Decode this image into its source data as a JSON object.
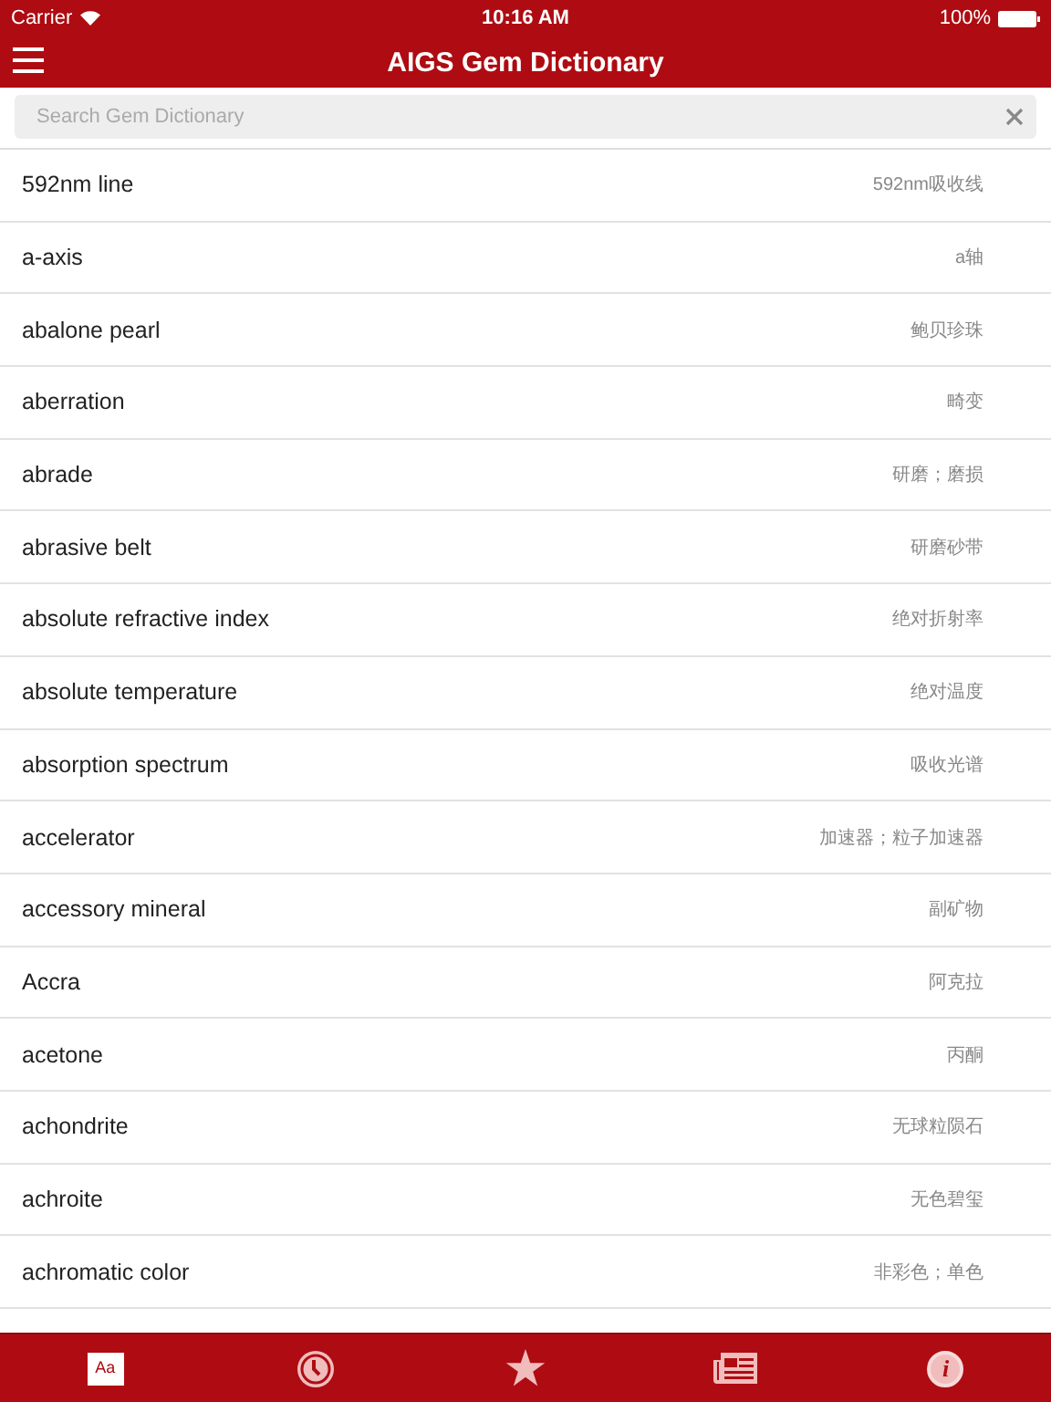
{
  "status_bar": {
    "carrier": "Carrier",
    "time": "10:16 AM",
    "battery": "100%"
  },
  "nav_bar": {
    "title": "AIGS Gem Dictionary"
  },
  "search": {
    "placeholder": "Search Gem Dictionary"
  },
  "entries": [
    {
      "term": "592nm line",
      "translation": "592nm吸收线"
    },
    {
      "term": "a-axis",
      "translation": "a轴"
    },
    {
      "term": "abalone pearl",
      "translation": "鲍贝珍珠"
    },
    {
      "term": "aberration",
      "translation": "畸变"
    },
    {
      "term": "abrade",
      "translation": "研磨；磨损"
    },
    {
      "term": "abrasive belt",
      "translation": "研磨砂带"
    },
    {
      "term": "absolute refractive index",
      "translation": "绝对折射率"
    },
    {
      "term": "absolute temperature",
      "translation": "绝对温度"
    },
    {
      "term": "absorption spectrum",
      "translation": "吸收光谱"
    },
    {
      "term": "accelerator",
      "translation": "加速器；粒子加速器"
    },
    {
      "term": "accessory mineral",
      "translation": "副矿物"
    },
    {
      "term": "Accra",
      "translation": "阿克拉"
    },
    {
      "term": "acetone",
      "translation": "丙酮"
    },
    {
      "term": "achondrite",
      "translation": "无球粒陨石"
    },
    {
      "term": "achroite",
      "translation": "无色碧玺"
    },
    {
      "term": "achromatic color",
      "translation": "非彩色；单色"
    }
  ],
  "tab_bar": [
    {
      "kind": "dictionary",
      "glyph": "Aa",
      "selected": true
    },
    {
      "kind": "history",
      "selected": false
    },
    {
      "kind": "favorites",
      "selected": false
    },
    {
      "kind": "news",
      "selected": false
    },
    {
      "kind": "info",
      "glyph": "i",
      "selected": false
    }
  ]
}
